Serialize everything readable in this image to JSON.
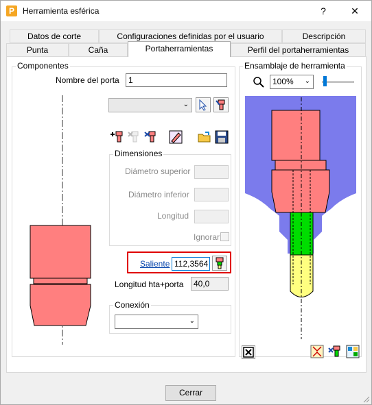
{
  "window": {
    "title": "Herramienta esférica",
    "app_icon_letter": "P",
    "help_glyph": "?",
    "close_glyph": "✕"
  },
  "tabs_row1": [
    "Datos de corte",
    "Configuraciones definidas por el usuario",
    "Descripción"
  ],
  "tabs_row2": [
    "Punta",
    "Caña",
    "Portaherramientas",
    "Perfil del portaherramientas"
  ],
  "components": {
    "group_label": "Componentes",
    "holder_name_label": "Nombre del porta",
    "holder_name_value": "1",
    "combo_value": "",
    "dimensions": {
      "label": "Dimensiones",
      "top_diameter_label": "Diámetro superior",
      "bottom_diameter_label": "Diámetro inferior",
      "length_label": "Longitud",
      "ignore_label": "Ignorar"
    },
    "overhang_label": "Saliente",
    "overhang_value": "112,3564",
    "total_length_label": "Longitud hta+porta",
    "total_length_value": "40,0",
    "connection": {
      "label": "Conexión",
      "value": ""
    }
  },
  "assembly": {
    "group_label": "Ensamblaje de herramienta",
    "zoom_value": "100%",
    "zoom_slider_fraction": 0.05
  },
  "footer": {
    "close_label": "Cerrar"
  },
  "colors": {
    "holder_fill": "#ff7f7f",
    "shank_fill": "#00dd00",
    "tip_fill": "#ffff80",
    "stock_fill": "#7b7bec",
    "highlight_border": "#e00000"
  }
}
